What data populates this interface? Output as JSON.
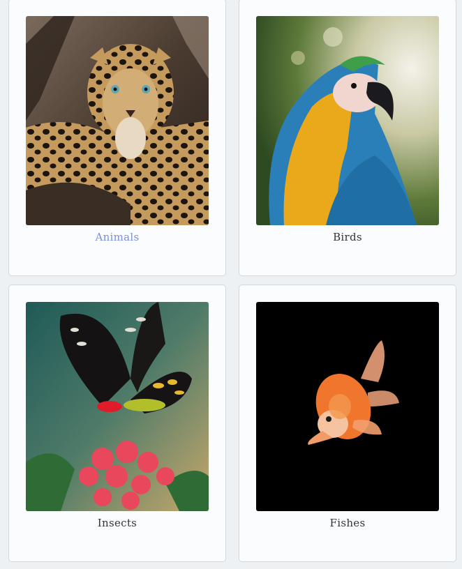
{
  "categories": [
    {
      "label": "Animals",
      "image_subject": "leopard",
      "active": true
    },
    {
      "label": "Birds",
      "image_subject": "macaw parrot",
      "active": false
    },
    {
      "label": "Insects",
      "image_subject": "butterfly on red flower",
      "active": false
    },
    {
      "label": "Fishes",
      "image_subject": "goldfish",
      "active": false
    }
  ],
  "colors": {
    "page_background": "#eef1f4",
    "card_background": "#fbfcfd",
    "card_border": "#d3d8dd",
    "label_text": "#333333",
    "label_active": "#7b8ee0"
  }
}
